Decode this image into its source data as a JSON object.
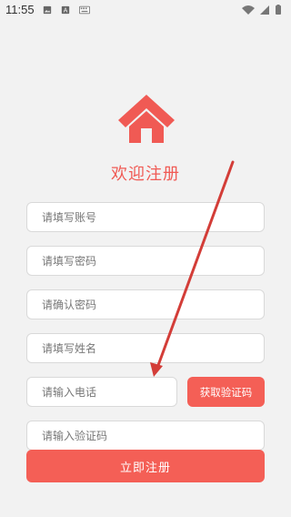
{
  "status_bar": {
    "time": "11:55",
    "icons_left": [
      "image-icon",
      "a-box-icon",
      "keyboard-icon"
    ],
    "icons_right": [
      "wifi-icon",
      "signal-icon",
      "battery-icon"
    ]
  },
  "registration": {
    "title": "欢迎注册",
    "fields": [
      {
        "placeholder": "请填写账号"
      },
      {
        "placeholder": "请填写密码"
      },
      {
        "placeholder": "请确认密码"
      },
      {
        "placeholder": "请填写姓名"
      },
      {
        "placeholder": "请输入电话"
      },
      {
        "placeholder": "请输入验证码"
      }
    ],
    "get_code_label": "获取验证码",
    "register_label": "立即注册"
  },
  "colors": {
    "accent": "#f45f56",
    "title": "#f05a54",
    "background": "#f2f2f2"
  }
}
